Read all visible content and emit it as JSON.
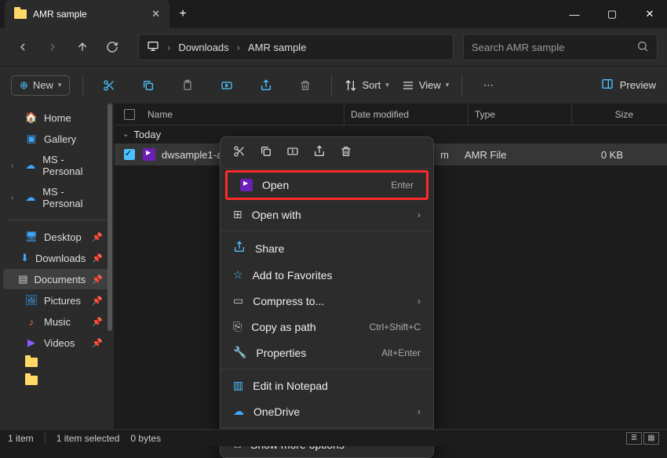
{
  "tab": {
    "title": "AMR sample"
  },
  "breadcrumb": {
    "seg1": "Downloads",
    "seg2": "AMR sample"
  },
  "search": {
    "placeholder": "Search AMR sample"
  },
  "toolbar": {
    "new": "New",
    "sort": "Sort",
    "view": "View",
    "preview": "Preview"
  },
  "sidebar": {
    "home": "Home",
    "gallery": "Gallery",
    "ms1": "MS - Personal",
    "ms2": "MS - Personal",
    "desktop": "Desktop",
    "downloads": "Downloads",
    "documents": "Documents",
    "pictures": "Pictures",
    "music": "Music",
    "videos": "Videos"
  },
  "columns": {
    "name": "Name",
    "date": "Date modified",
    "type": "Type",
    "size": "Size"
  },
  "group": {
    "today": "Today"
  },
  "file": {
    "name": "dwsample1-a",
    "date_suffix": "m",
    "type": "AMR File",
    "size": "0 KB"
  },
  "context": {
    "open": "Open",
    "open_sc": "Enter",
    "openwith": "Open with",
    "share": "Share",
    "fav": "Add to Favorites",
    "compress": "Compress to...",
    "copypath": "Copy as path",
    "copypath_sc": "Ctrl+Shift+C",
    "properties": "Properties",
    "properties_sc": "Alt+Enter",
    "notepad": "Edit in Notepad",
    "onedrive": "OneDrive",
    "more": "Show more options"
  },
  "status": {
    "items": "1 item",
    "selected": "1 item selected",
    "size": "0 bytes"
  }
}
